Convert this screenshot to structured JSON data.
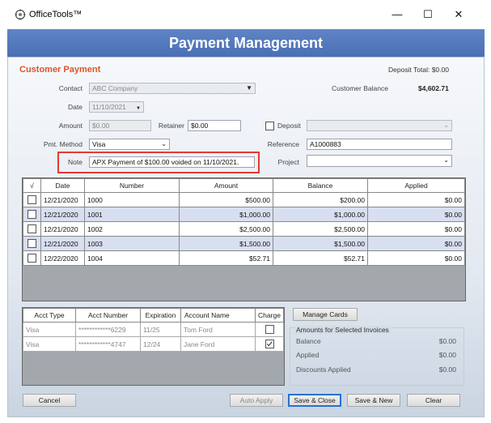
{
  "window": {
    "app_title": "OfficeTools™",
    "minimize": "—",
    "maximize": "☐",
    "close": "✕"
  },
  "header": {
    "title": "Payment Management"
  },
  "section": {
    "title": "Customer Payment",
    "deposit_total": "Deposit Total: $0.00"
  },
  "form": {
    "contact_label": "Contact",
    "contact_value": "ABC Company",
    "date_label": "Date",
    "date_value": "11/10/2021",
    "amount_label": "Amount",
    "amount_value": "$0.00",
    "retainer_label": "Retainer",
    "retainer_value": "$0.00",
    "deposit_label": "Deposit",
    "deposit_value": "",
    "pmt_method_label": "Pmt. Method",
    "pmt_method_value": "Visa",
    "reference_label": "Reference",
    "reference_value": "A1000883",
    "note_label": "Note",
    "note_value": "APX Payment of $100.00 voided on 11/10/2021.",
    "project_label": "Project",
    "project_value": "",
    "customer_balance_label": "Customer Balance",
    "customer_balance_value": "$4,602.71"
  },
  "invoices": {
    "columns": [
      "√",
      "Date",
      "Number",
      "Amount",
      "Balance",
      "Applied"
    ],
    "rows": [
      {
        "date": "12/21/2020",
        "number": "1000",
        "amount": "$500.00",
        "balance": "$200.00",
        "applied": "$0.00"
      },
      {
        "date": "12/21/2020",
        "number": "1001",
        "amount": "$1,000.00",
        "balance": "$1,000.00",
        "applied": "$0.00"
      },
      {
        "date": "12/21/2020",
        "number": "1002",
        "amount": "$2,500.00",
        "balance": "$2,500.00",
        "applied": "$0.00"
      },
      {
        "date": "12/21/2020",
        "number": "1003",
        "amount": "$1,500.00",
        "balance": "$1,500.00",
        "applied": "$0.00"
      },
      {
        "date": "12/22/2020",
        "number": "1004",
        "amount": "$52.71",
        "balance": "$52.71",
        "applied": "$0.00"
      }
    ]
  },
  "cards": {
    "columns": [
      "Acct Type",
      "Acct Number",
      "Expiration",
      "Account Name",
      "Charge"
    ],
    "rows": [
      {
        "type": "Visa",
        "number": "************6229",
        "expiration": "11/25",
        "name": "Tom Ford",
        "charge": false
      },
      {
        "type": "Visa",
        "number": "************4747",
        "expiration": "12/24",
        "name": "Jane Ford",
        "charge": true
      }
    ],
    "manage_label": "Manage Cards"
  },
  "amounts": {
    "title": "Amounts for Selected Invoices",
    "balance_label": "Balance",
    "balance_value": "$0.00",
    "applied_label": "Applied",
    "applied_value": "$0.00",
    "discounts_label": "Discounts Applied",
    "discounts_value": "$0.00"
  },
  "buttons": {
    "cancel": "Cancel",
    "auto_apply": "Auto Apply",
    "save_close": "Save & Close",
    "save_new": "Save & New",
    "clear": "Clear"
  },
  "colors": {
    "header": "#4a6fb5",
    "section_title": "#e0532a",
    "alt_row": "#d8dff0",
    "highlight": "#e53935",
    "primary_border": "#2a6fd0"
  }
}
